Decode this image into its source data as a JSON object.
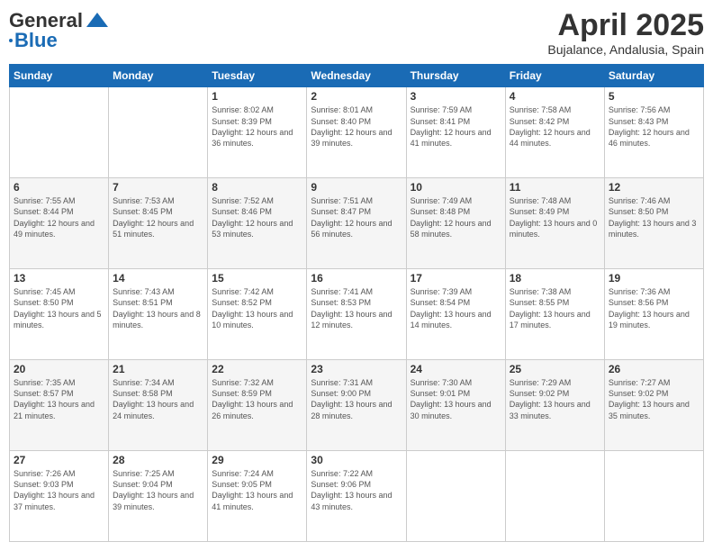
{
  "header": {
    "logo_general": "General",
    "logo_blue": "Blue",
    "month_title": "April 2025",
    "subtitle": "Bujalance, Andalusia, Spain"
  },
  "days_of_week": [
    "Sunday",
    "Monday",
    "Tuesday",
    "Wednesday",
    "Thursday",
    "Friday",
    "Saturday"
  ],
  "weeks": [
    [
      {
        "day": "",
        "info": ""
      },
      {
        "day": "",
        "info": ""
      },
      {
        "day": "1",
        "info": "Sunrise: 8:02 AM\nSunset: 8:39 PM\nDaylight: 12 hours and 36 minutes."
      },
      {
        "day": "2",
        "info": "Sunrise: 8:01 AM\nSunset: 8:40 PM\nDaylight: 12 hours and 39 minutes."
      },
      {
        "day": "3",
        "info": "Sunrise: 7:59 AM\nSunset: 8:41 PM\nDaylight: 12 hours and 41 minutes."
      },
      {
        "day": "4",
        "info": "Sunrise: 7:58 AM\nSunset: 8:42 PM\nDaylight: 12 hours and 44 minutes."
      },
      {
        "day": "5",
        "info": "Sunrise: 7:56 AM\nSunset: 8:43 PM\nDaylight: 12 hours and 46 minutes."
      }
    ],
    [
      {
        "day": "6",
        "info": "Sunrise: 7:55 AM\nSunset: 8:44 PM\nDaylight: 12 hours and 49 minutes."
      },
      {
        "day": "7",
        "info": "Sunrise: 7:53 AM\nSunset: 8:45 PM\nDaylight: 12 hours and 51 minutes."
      },
      {
        "day": "8",
        "info": "Sunrise: 7:52 AM\nSunset: 8:46 PM\nDaylight: 12 hours and 53 minutes."
      },
      {
        "day": "9",
        "info": "Sunrise: 7:51 AM\nSunset: 8:47 PM\nDaylight: 12 hours and 56 minutes."
      },
      {
        "day": "10",
        "info": "Sunrise: 7:49 AM\nSunset: 8:48 PM\nDaylight: 12 hours and 58 minutes."
      },
      {
        "day": "11",
        "info": "Sunrise: 7:48 AM\nSunset: 8:49 PM\nDaylight: 13 hours and 0 minutes."
      },
      {
        "day": "12",
        "info": "Sunrise: 7:46 AM\nSunset: 8:50 PM\nDaylight: 13 hours and 3 minutes."
      }
    ],
    [
      {
        "day": "13",
        "info": "Sunrise: 7:45 AM\nSunset: 8:50 PM\nDaylight: 13 hours and 5 minutes."
      },
      {
        "day": "14",
        "info": "Sunrise: 7:43 AM\nSunset: 8:51 PM\nDaylight: 13 hours and 8 minutes."
      },
      {
        "day": "15",
        "info": "Sunrise: 7:42 AM\nSunset: 8:52 PM\nDaylight: 13 hours and 10 minutes."
      },
      {
        "day": "16",
        "info": "Sunrise: 7:41 AM\nSunset: 8:53 PM\nDaylight: 13 hours and 12 minutes."
      },
      {
        "day": "17",
        "info": "Sunrise: 7:39 AM\nSunset: 8:54 PM\nDaylight: 13 hours and 14 minutes."
      },
      {
        "day": "18",
        "info": "Sunrise: 7:38 AM\nSunset: 8:55 PM\nDaylight: 13 hours and 17 minutes."
      },
      {
        "day": "19",
        "info": "Sunrise: 7:36 AM\nSunset: 8:56 PM\nDaylight: 13 hours and 19 minutes."
      }
    ],
    [
      {
        "day": "20",
        "info": "Sunrise: 7:35 AM\nSunset: 8:57 PM\nDaylight: 13 hours and 21 minutes."
      },
      {
        "day": "21",
        "info": "Sunrise: 7:34 AM\nSunset: 8:58 PM\nDaylight: 13 hours and 24 minutes."
      },
      {
        "day": "22",
        "info": "Sunrise: 7:32 AM\nSunset: 8:59 PM\nDaylight: 13 hours and 26 minutes."
      },
      {
        "day": "23",
        "info": "Sunrise: 7:31 AM\nSunset: 9:00 PM\nDaylight: 13 hours and 28 minutes."
      },
      {
        "day": "24",
        "info": "Sunrise: 7:30 AM\nSunset: 9:01 PM\nDaylight: 13 hours and 30 minutes."
      },
      {
        "day": "25",
        "info": "Sunrise: 7:29 AM\nSunset: 9:02 PM\nDaylight: 13 hours and 33 minutes."
      },
      {
        "day": "26",
        "info": "Sunrise: 7:27 AM\nSunset: 9:02 PM\nDaylight: 13 hours and 35 minutes."
      }
    ],
    [
      {
        "day": "27",
        "info": "Sunrise: 7:26 AM\nSunset: 9:03 PM\nDaylight: 13 hours and 37 minutes."
      },
      {
        "day": "28",
        "info": "Sunrise: 7:25 AM\nSunset: 9:04 PM\nDaylight: 13 hours and 39 minutes."
      },
      {
        "day": "29",
        "info": "Sunrise: 7:24 AM\nSunset: 9:05 PM\nDaylight: 13 hours and 41 minutes."
      },
      {
        "day": "30",
        "info": "Sunrise: 7:22 AM\nSunset: 9:06 PM\nDaylight: 13 hours and 43 minutes."
      },
      {
        "day": "",
        "info": ""
      },
      {
        "day": "",
        "info": ""
      },
      {
        "day": "",
        "info": ""
      }
    ]
  ]
}
